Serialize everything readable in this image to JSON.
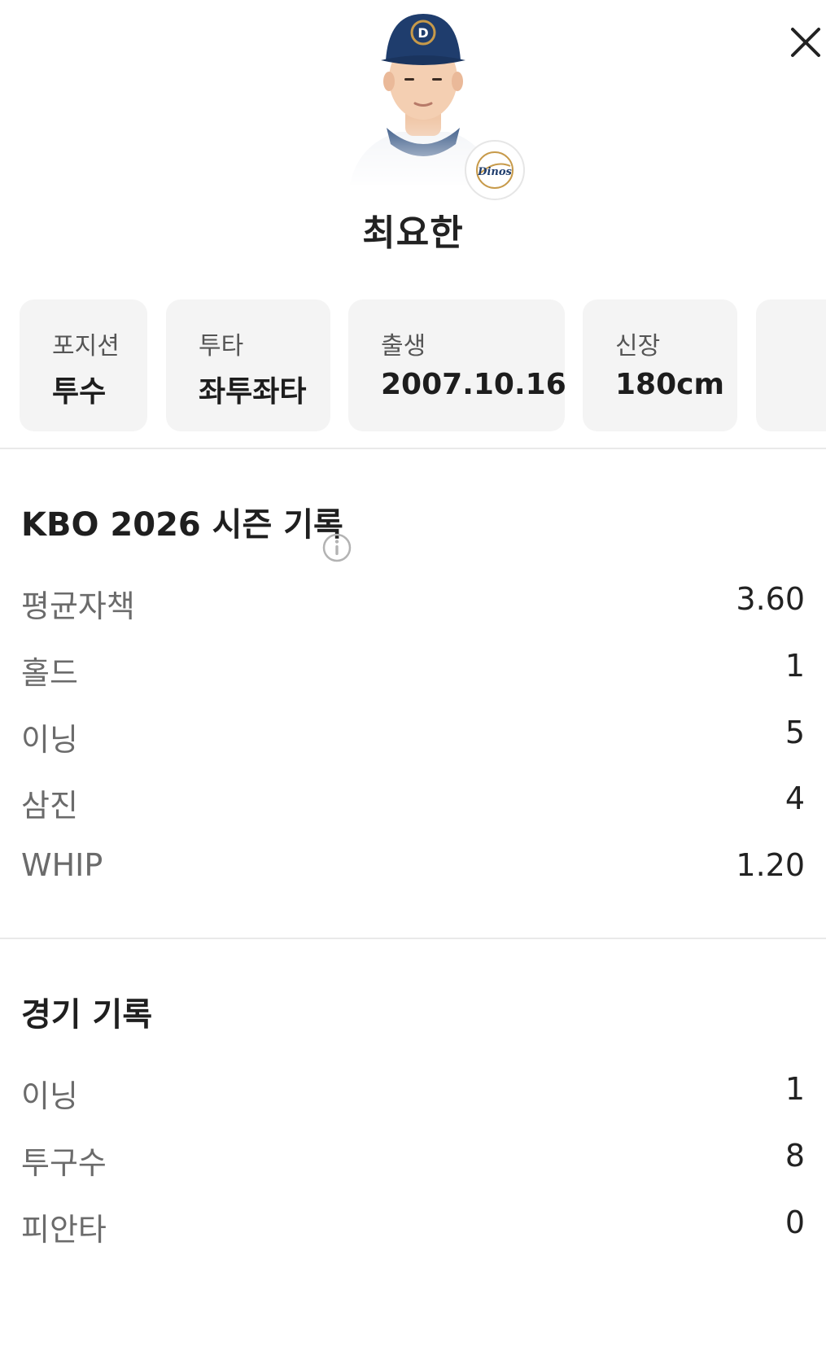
{
  "header": {
    "close_label": "close",
    "player_name": "최요한",
    "team_logo_text": "Dinos"
  },
  "info_cards": [
    {
      "label": "포지션",
      "value": "투수"
    },
    {
      "label": "투타",
      "value": "좌투좌타"
    },
    {
      "label": "출생",
      "value": "2007.10.16"
    },
    {
      "label": "신장",
      "value": "180cm"
    }
  ],
  "season": {
    "title": "KBO 2026 시즌 기록",
    "stats": [
      {
        "label": "평균자책",
        "value": "3.60"
      },
      {
        "label": "홀드",
        "value": "1"
      },
      {
        "label": "이닝",
        "value": "5"
      },
      {
        "label": "삼진",
        "value": "4"
      },
      {
        "label": "WHIP",
        "value": "1.20"
      }
    ]
  },
  "game": {
    "title": "경기 기록",
    "stats": [
      {
        "label": "이닝",
        "value": "1"
      },
      {
        "label": "투구수",
        "value": "8"
      },
      {
        "label": "피안타",
        "value": "0"
      }
    ]
  },
  "colors": {
    "card_bg": "#f4f4f4",
    "team_navy": "#1f3d6d",
    "team_gold": "#c79a4a"
  }
}
